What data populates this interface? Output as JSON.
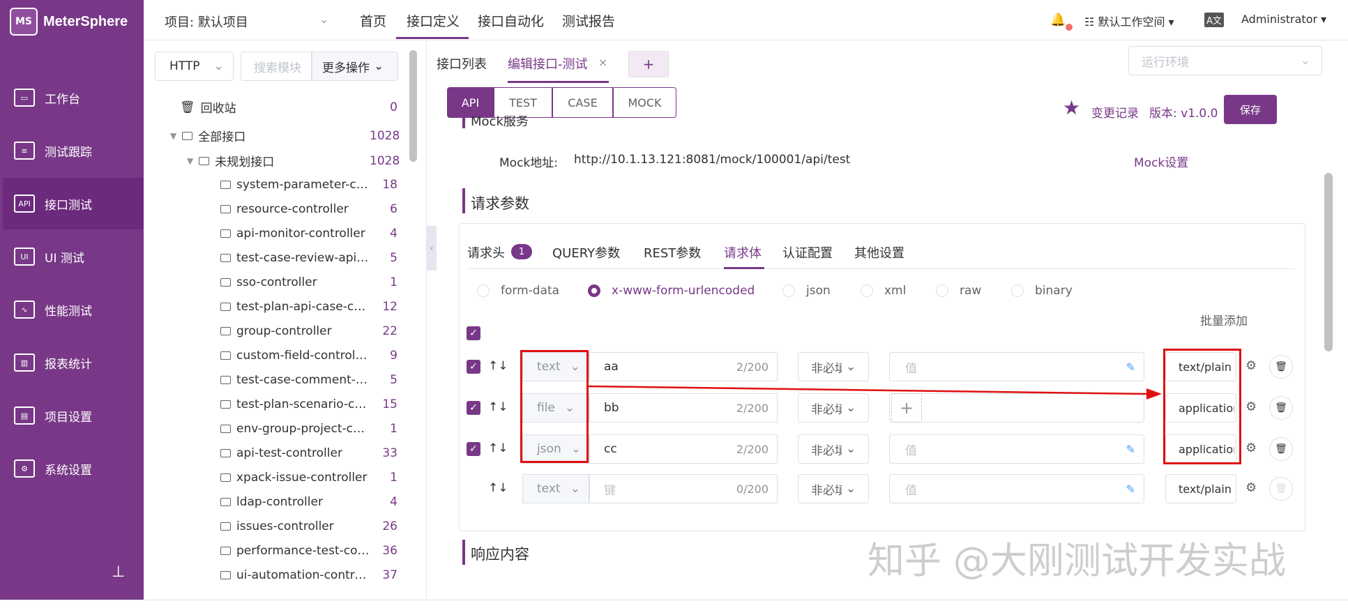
{
  "app": {
    "brand": "MeterSphere",
    "logo_text": "MS"
  },
  "sidebar": {
    "items": [
      {
        "label": "工作台",
        "icon": "monitor-icon",
        "glyph": "▭"
      },
      {
        "label": "测试跟踪",
        "icon": "clipboard-icon",
        "glyph": "≡"
      },
      {
        "label": "接口测试",
        "icon": "api-icon",
        "glyph": "API"
      },
      {
        "label": "UI 测试",
        "icon": "ui-icon",
        "glyph": "UI"
      },
      {
        "label": "性能测试",
        "icon": "chart-icon",
        "glyph": "∿"
      },
      {
        "label": "报表统计",
        "icon": "report-icon",
        "glyph": "▥"
      },
      {
        "label": "项目设置",
        "icon": "folder-icon",
        "glyph": "▤"
      },
      {
        "label": "系统设置",
        "icon": "gears-icon",
        "glyph": "⚙"
      }
    ],
    "active_index": 2,
    "pin_glyph": "⊥"
  },
  "topbar": {
    "project": "项目: 默认项目",
    "tabs": [
      "首页",
      "接口定义",
      "接口自动化",
      "测试报告"
    ],
    "active_tab": 1,
    "workspace": "默认工作空间",
    "lang": "A文",
    "user": "Administrator"
  },
  "tree": {
    "protocol": "HTTP",
    "search_placeholder": "搜索模块",
    "more_ops": "更多操作",
    "recycle": {
      "label": "回收站",
      "count": "0"
    },
    "all": {
      "label": "全部接口",
      "count": "1028"
    },
    "unplanned": {
      "label": "未规划接口",
      "count": "1028"
    },
    "modules": [
      {
        "label": "system-parameter-controller",
        "count": "18"
      },
      {
        "label": "resource-controller",
        "count": "6"
      },
      {
        "label": "api-monitor-controller",
        "count": "4"
      },
      {
        "label": "test-case-review-api-case-controller",
        "count": "5"
      },
      {
        "label": "sso-controller",
        "count": "1"
      },
      {
        "label": "test-plan-api-case-controller",
        "count": "12"
      },
      {
        "label": "group-controller",
        "count": "22"
      },
      {
        "label": "custom-field-controller",
        "count": "9"
      },
      {
        "label": "test-case-comment-controller",
        "count": "5"
      },
      {
        "label": "test-plan-scenario-case-controller",
        "count": "15"
      },
      {
        "label": "env-group-project-controller",
        "count": "1"
      },
      {
        "label": "api-test-controller",
        "count": "33"
      },
      {
        "label": "xpack-issue-controller",
        "count": "1"
      },
      {
        "label": "ldap-controller",
        "count": "4"
      },
      {
        "label": "issues-controller",
        "count": "26"
      },
      {
        "label": "performance-test-controller",
        "count": "36"
      },
      {
        "label": "ui-automation-controller",
        "count": "37"
      }
    ]
  },
  "main": {
    "tabs": [
      "接口列表",
      "编辑接口-测试"
    ],
    "close_glyph": "×",
    "add_glyph": "+",
    "env_placeholder": "运行环境",
    "modes": [
      "API",
      "TEST",
      "CASE",
      "MOCK"
    ],
    "changelog": "变更记录",
    "version": "版本: v1.0.0",
    "save": "保存",
    "mock": {
      "title": "Mock服务",
      "label": "Mock地址:",
      "url": "http://10.1.13.121:8081/mock/100001/api/test",
      "settings": "Mock设置"
    },
    "request": {
      "title": "请求参数",
      "tabs": [
        "请求头",
        "QUERY参数",
        "REST参数",
        "请求体",
        "认证配置",
        "其他设置"
      ],
      "header_badge": "1",
      "active_tab": 3,
      "body_types": [
        "form-data",
        "x-www-form-urlencoded",
        "json",
        "xml",
        "raw",
        "binary"
      ],
      "active_body_type": 1,
      "batch_add": "批量添加",
      "rows": [
        {
          "checked": true,
          "type": "text",
          "key": "aa",
          "count": "2/200",
          "required": "非必填",
          "value": "值",
          "content_type": "text/plain"
        },
        {
          "checked": true,
          "type": "file",
          "key": "bb",
          "count": "2/200",
          "required": "非必填",
          "value": "",
          "content_type": "application/octet-stream"
        },
        {
          "checked": true,
          "type": "json",
          "key": "cc",
          "count": "2/200",
          "required": "非必填",
          "value": "值",
          "content_type": "application/json"
        },
        {
          "checked": false,
          "type": "text",
          "key": "键",
          "count": "0/200",
          "required": "非必填",
          "value": "值",
          "content_type": "text/plain"
        }
      ]
    },
    "response_title": "响应内容"
  },
  "watermark": "知乎 @大刚测试开发实战",
  "colors": {
    "brand": "#783887",
    "annotation": "#e01010"
  }
}
